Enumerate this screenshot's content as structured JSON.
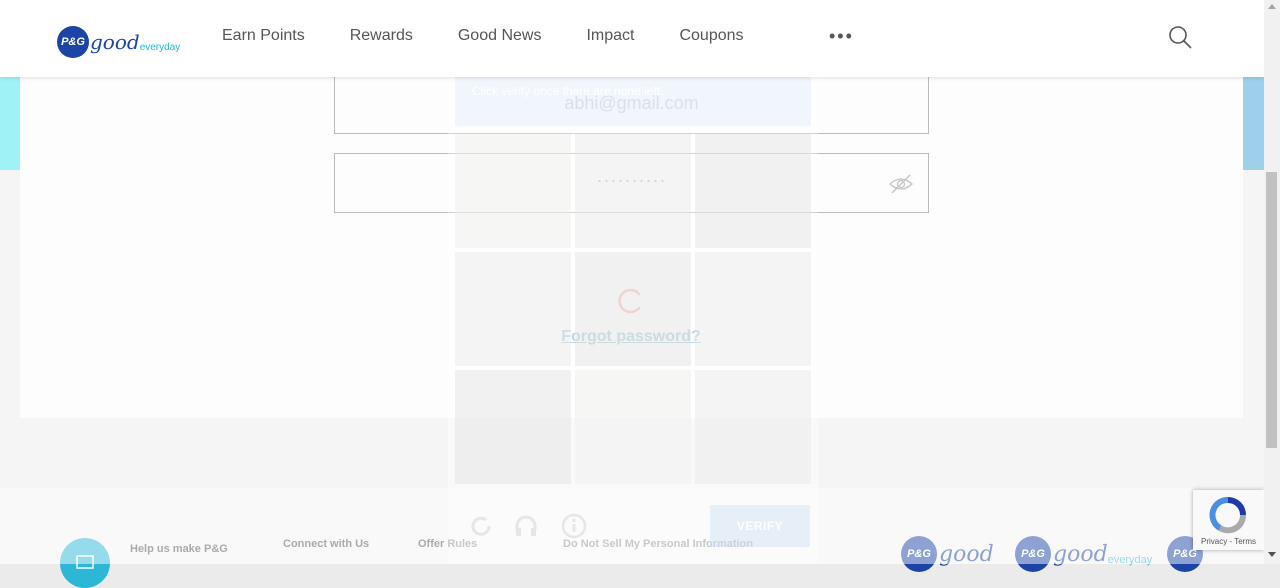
{
  "header": {
    "logo_mark": "P&G",
    "logo_word": "good",
    "logo_suffix": "everyday",
    "nav": [
      "Earn Points",
      "Rewards",
      "Good News",
      "Impact",
      "Coupons"
    ],
    "more": "•••"
  },
  "login": {
    "email_value": "abhi@gmail.com",
    "password_masked": "··········",
    "forgot_link": "Forgot password?"
  },
  "captcha": {
    "instruction": "Click verify once there are none left.",
    "verify_label": "VERIFY"
  },
  "footer": {
    "links": [
      "Help us make P&G",
      "Connect with Us",
      "Offer Rules",
      "Do Not Sell My Personal Information"
    ],
    "logo_mark": "P&G",
    "logo_word": "good",
    "logo_suffix": "everyday"
  },
  "recaptcha": {
    "links": "Privacy - Terms"
  },
  "colors": {
    "brand_blue": "#1b44a6",
    "accent_cyan": "#2cb7d6",
    "link_blue": "#2d7fb0",
    "spinner_red": "#e85c41"
  }
}
